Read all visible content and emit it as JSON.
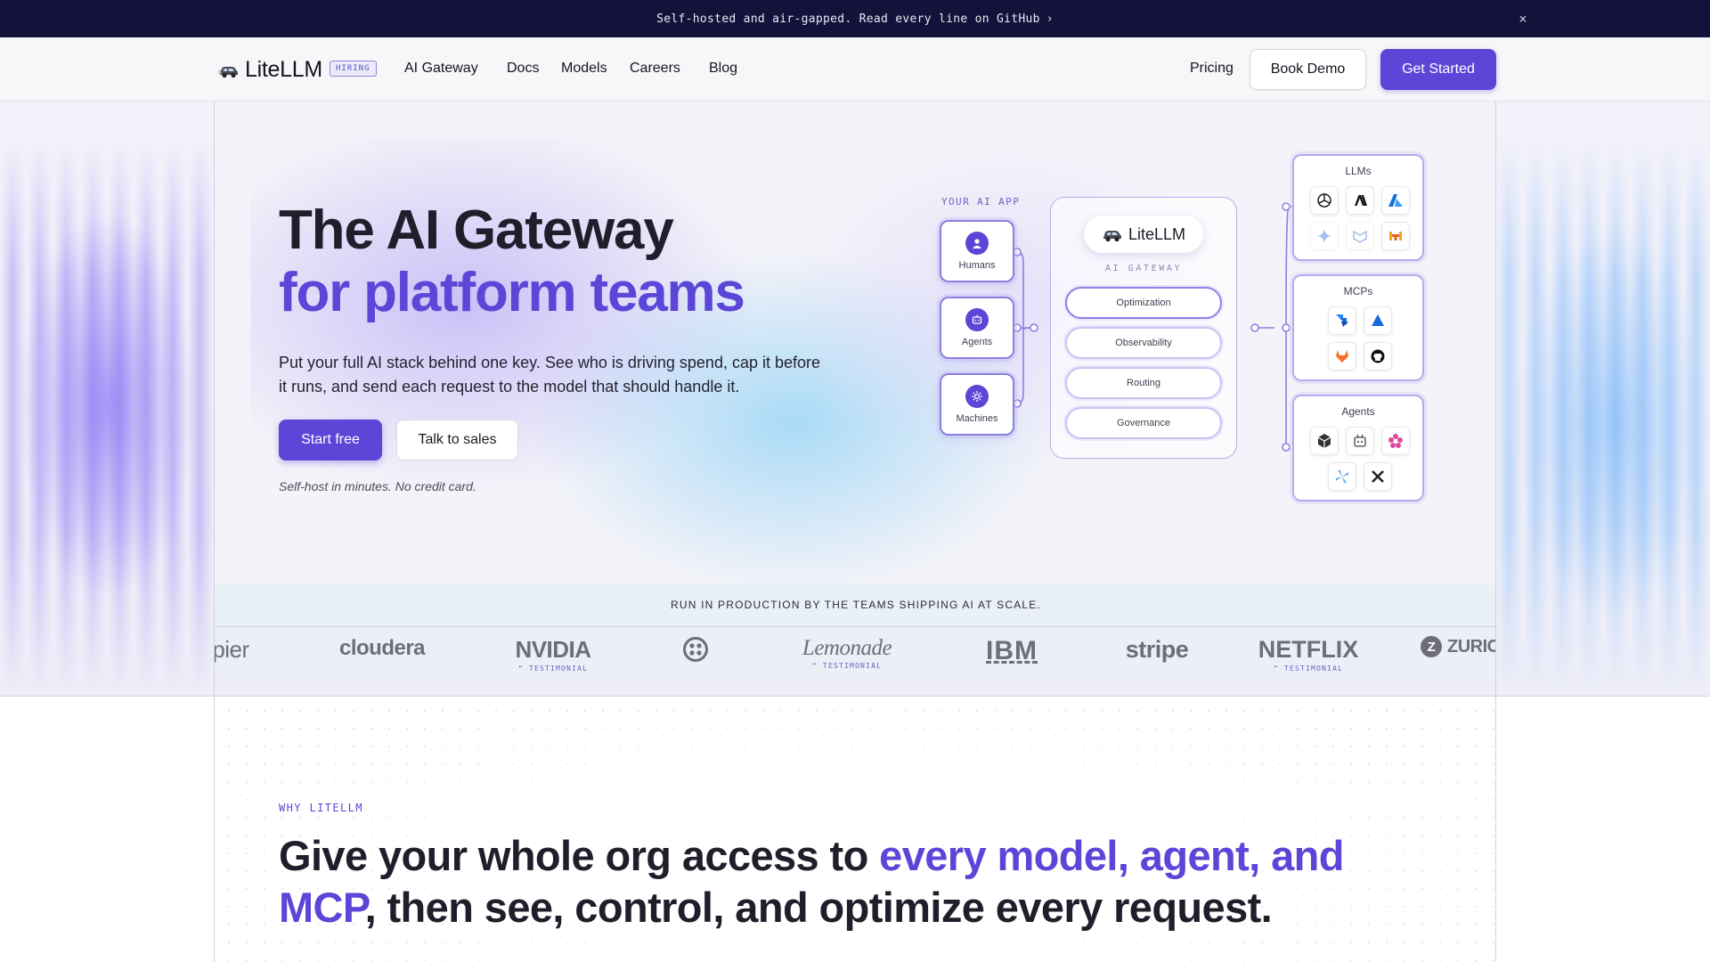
{
  "announcement": {
    "text": "Self-hosted and air-gapped. Read every line on GitHub",
    "arrow": "›",
    "close": "×"
  },
  "nav": {
    "brand": "LiteLLM",
    "hiring_badge": "HIRING",
    "links": [
      "AI Gateway",
      "Docs",
      "Models",
      "Careers",
      "Blog"
    ],
    "pricing": "Pricing",
    "book_demo": "Book Demo",
    "get_started": "Get Started"
  },
  "hero": {
    "title_line1": "The AI Gateway",
    "title_line2": "for platform teams",
    "subtitle": "Put your full AI stack behind one key. See who is driving spend, cap it before it runs, and send each request to the model that should handle it.",
    "start_free": "Start free",
    "talk_to_sales": "Talk to sales",
    "note": "Self-host in minutes. No credit card."
  },
  "diagram": {
    "your_app_label": "YOUR AI APP",
    "sources": [
      {
        "label": "Humans",
        "icon": "user-icon"
      },
      {
        "label": "Agents",
        "icon": "robot-icon"
      },
      {
        "label": "Machines",
        "icon": "gear-icon"
      }
    ],
    "gateway": {
      "brand": "LiteLLM",
      "label": "AI GATEWAY",
      "features": [
        "Optimization",
        "Observability",
        "Routing",
        "Governance"
      ]
    },
    "panels": [
      {
        "title": "LLMs",
        "icons": [
          "openai-icon",
          "anthropic-icon",
          "azure-icon",
          "gemini-icon",
          "meta-icon",
          "mistral-icon"
        ]
      },
      {
        "title": "MCPs",
        "icons": [
          "jira-icon",
          "confluence-icon",
          "gitlab-icon",
          "github-icon"
        ]
      },
      {
        "title": "Agents",
        "icons": [
          "cube-agent-icon",
          "bot-agent-icon",
          "flower-agent-icon",
          "pinwheel-agent-icon",
          "x-agent-icon"
        ]
      }
    ]
  },
  "trusted": {
    "heading": "RUN IN PRODUCTION BY THE TEAMS SHIPPING AI AT SCALE.",
    "logos": [
      {
        "name": "pier",
        "testimonial": ""
      },
      {
        "name": "cloudera",
        "testimonial": ""
      },
      {
        "name": "NVIDIA",
        "testimonial": "TESTIMONIAL"
      },
      {
        "name": "twilio",
        "testimonial": ""
      },
      {
        "name": "Lemonade",
        "testimonial": "TESTIMONIAL"
      },
      {
        "name": "IBM",
        "testimonial": ""
      },
      {
        "name": "stripe",
        "testimonial": ""
      },
      {
        "name": "NETFLIX",
        "testimonial": "TESTIMONIAL"
      },
      {
        "name": "ZURIC",
        "testimonial": ""
      }
    ]
  },
  "why": {
    "eyebrow": "WHY LITELLM",
    "title_part1": "Give your whole org access to ",
    "title_accent": "every model, agent, and MCP",
    "title_part2": ", then see, control, and optimize every request."
  },
  "colors": {
    "accent": "#5b46d8",
    "announcement_bg": "#13123a",
    "text": "#1f1f2c"
  }
}
